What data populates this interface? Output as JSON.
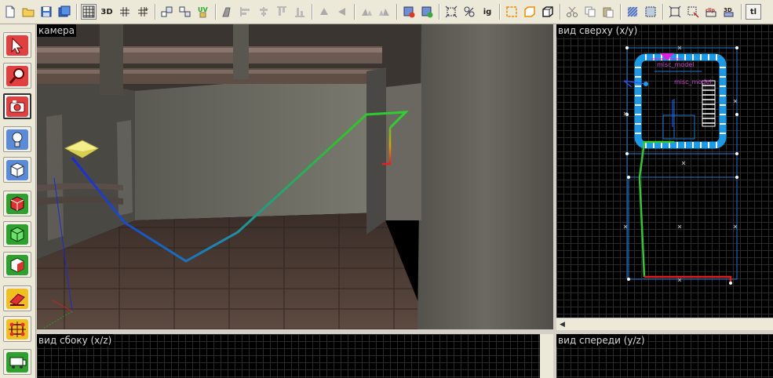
{
  "viewports": {
    "camera": {
      "label": "камера"
    },
    "top": {
      "label": "вид сверху (x/y)"
    },
    "side": {
      "label": "вид сбоку (x/z)"
    },
    "front": {
      "label": "вид спереди (y/z)"
    }
  },
  "toolbar": {
    "text_buttons": {
      "ig": "ig",
      "tl": "tl"
    },
    "icons": [
      "new-file-icon",
      "open-folder-icon",
      "save-icon",
      "save-all-icon",
      "grid-icon",
      "3d-grid-icon",
      "grid-smaller-icon",
      "grid-larger-icon",
      "group-icon",
      "ungroup-icon",
      "uv-icon",
      "texture-lock-icon",
      "align-left-icon",
      "align-center-icon",
      "align-top-icon",
      "align-bottom-icon",
      "flip-horizontal-icon",
      "flip-vertical-icon",
      "rotate-left-icon",
      "rotate-right-icon",
      "select-red-icon",
      "select-green-icon",
      "select-region-icon",
      "hide-icon",
      "carve-icon",
      "hollow-icon",
      "make-solid-icon",
      "cut-icon",
      "copy-icon",
      "paste-icon",
      "texture-app-icon",
      "selection-box-icon",
      "vertex-icon",
      "edges-icon",
      "3d-view-icon"
    ],
    "colors": {
      "accent_orange": "#f08a00",
      "accent_red": "#d42020"
    }
  },
  "tools": [
    {
      "name": "selection-tool-icon",
      "active": false
    },
    {
      "name": "zoom-tool-icon",
      "active": false
    },
    {
      "name": "camera-tool-icon",
      "active": true
    },
    {
      "name": "entity-light-tool-icon",
      "active": false
    },
    {
      "name": "block-tool-icon",
      "active": false
    },
    {
      "name": "texture-apply-icon",
      "active": false
    },
    {
      "name": "apply-current-texture-icon",
      "active": false
    },
    {
      "name": "decal-tool-icon",
      "active": false
    },
    {
      "name": "clip-tool-icon",
      "active": false
    },
    {
      "name": "vertex-manipulation-icon",
      "active": false
    },
    {
      "name": "path-tool-icon",
      "active": false
    }
  ],
  "top_view_entities": {
    "misc_labels": [
      "misc_model",
      "misc_model"
    ],
    "colors": {
      "brush": "#1a9be8",
      "path_green": "#2ecc2e",
      "path_red": "#e01e1e",
      "entity": "#e01ee0"
    }
  }
}
